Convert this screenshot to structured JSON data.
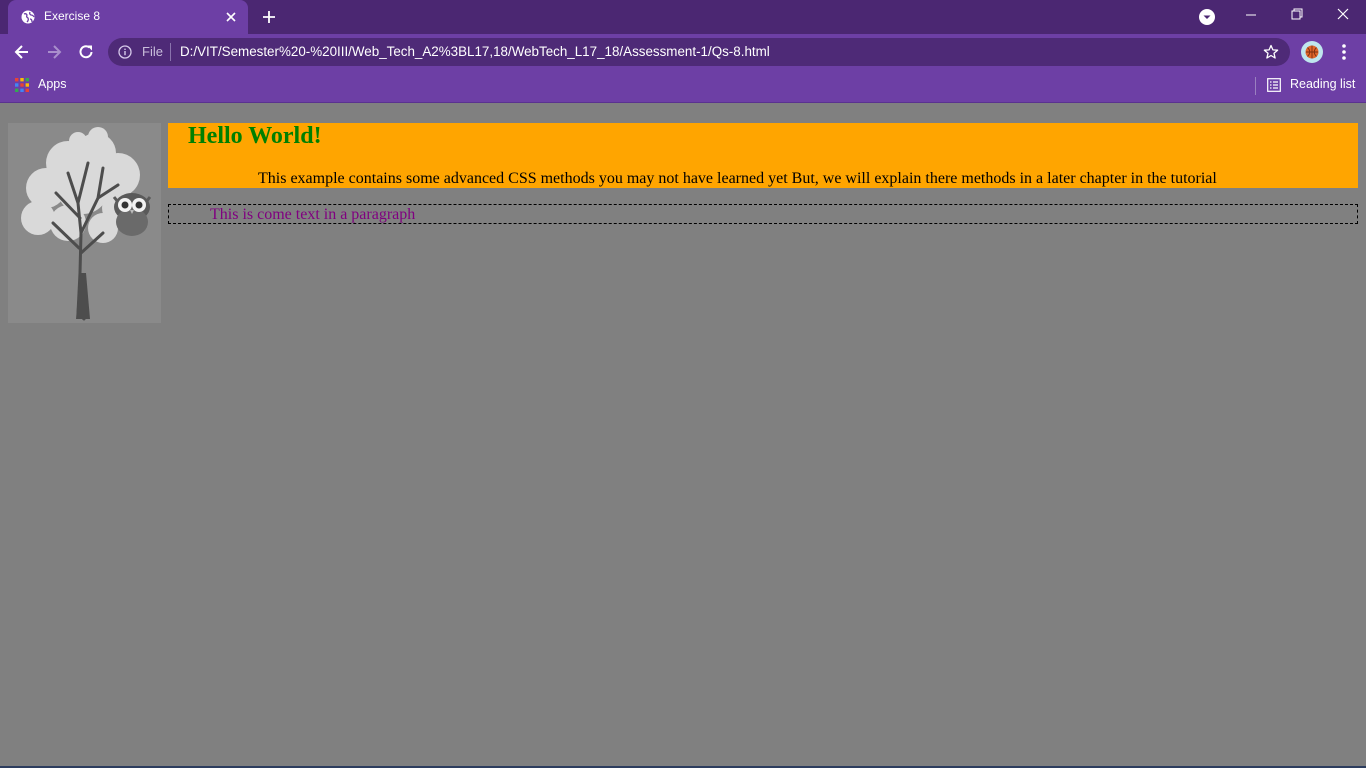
{
  "browser": {
    "tab": {
      "title": "Exercise 8"
    },
    "omnibox": {
      "scheme_label": "File",
      "url": "D:/VIT/Semester%20-%20III/Web_Tech_A2%3BL17,18/WebTech_L17_18/Assessment-1/Qs-8.html"
    },
    "bookmarks": {
      "apps_label": "Apps",
      "reading_list_label": "Reading list"
    },
    "colors": {
      "frame": "#4b2772",
      "toolbar": "#6d3fa5",
      "omnibox": "#4e2a77"
    }
  },
  "page": {
    "background": "#808080",
    "header": {
      "heading": "Hello World!",
      "text": "This example contains some advanced CSS methods you may not have learned yet But, we will explain there methods in a later chapter in the tutorial",
      "background": "#ffa500",
      "heading_color": "#008000"
    },
    "paragraph": {
      "text": "This is come text in a paragraph",
      "color": "#800080"
    },
    "image": {
      "subject": "tree-with-owl"
    }
  },
  "icons": {
    "favicon": "globe-icon",
    "tab_close": "close-icon",
    "new_tab": "plus-icon",
    "tab_search": "chevron-down-circle-icon",
    "back": "arrow-left-icon",
    "forward": "arrow-right-icon",
    "reload": "reload-icon",
    "info": "info-icon",
    "bookmark": "star-icon",
    "profile": "avatar-icon",
    "menu": "kebab-menu-icon",
    "apps": "apps-grid-icon",
    "reading_list": "reading-list-icon"
  }
}
